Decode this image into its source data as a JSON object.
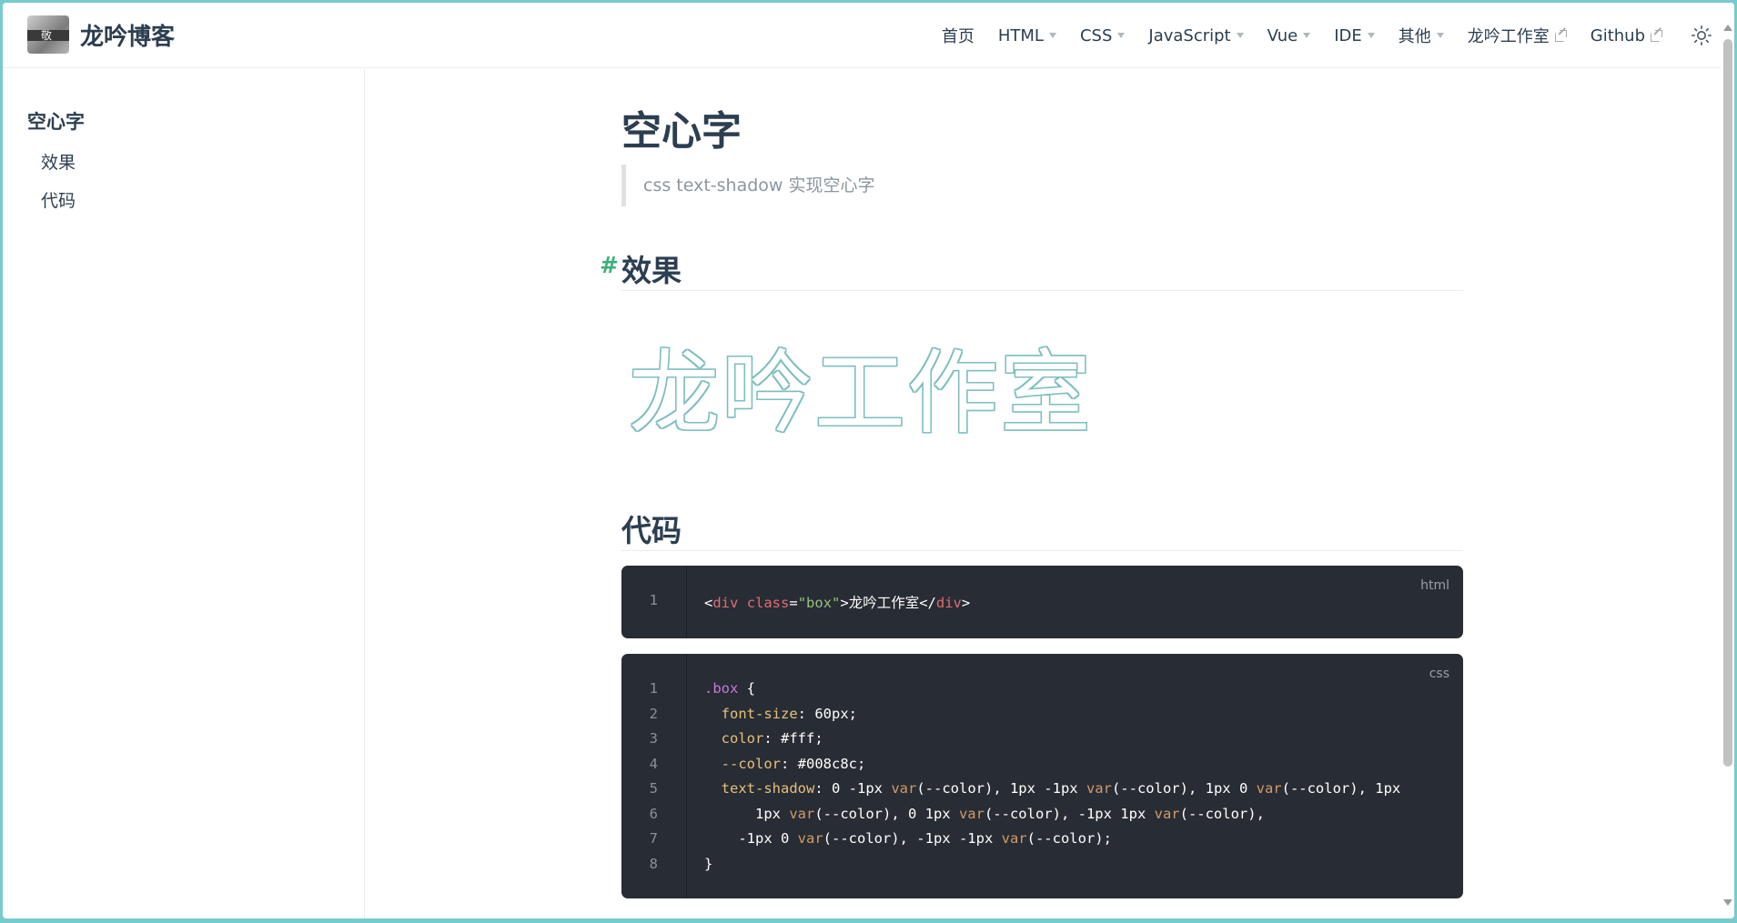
{
  "site": {
    "name": "龙吟博客",
    "logo_text": "敬"
  },
  "nav": {
    "items": [
      {
        "label": "首页",
        "dropdown": false,
        "external": false
      },
      {
        "label": "HTML",
        "dropdown": true,
        "external": false
      },
      {
        "label": "CSS",
        "dropdown": true,
        "external": false
      },
      {
        "label": "JavaScript",
        "dropdown": true,
        "external": false
      },
      {
        "label": "Vue",
        "dropdown": true,
        "external": false
      },
      {
        "label": "IDE",
        "dropdown": true,
        "external": false
      },
      {
        "label": "其他",
        "dropdown": true,
        "external": false
      },
      {
        "label": "龙吟工作室",
        "dropdown": false,
        "external": true
      },
      {
        "label": "Github",
        "dropdown": false,
        "external": true
      }
    ],
    "theme_icon": "sun-icon"
  },
  "sidebar": {
    "title": "空心字",
    "items": [
      {
        "label": "效果"
      },
      {
        "label": "代码"
      }
    ]
  },
  "page": {
    "title": "空心字",
    "quote": "css text-shadow 实现空心字",
    "h2_effect": "效果",
    "anchor": "#",
    "demo_text": "龙吟工作室",
    "h2_code": "代码"
  },
  "code_html": {
    "lang": "html",
    "line_numbers": [
      "1"
    ],
    "lines": [
      [
        {
          "t": "<",
          "c": ""
        },
        {
          "t": "div",
          "c": "tk-tag"
        },
        {
          "t": " ",
          "c": ""
        },
        {
          "t": "class",
          "c": "tk-attr"
        },
        {
          "t": "=",
          "c": ""
        },
        {
          "t": "\"box\"",
          "c": "tk-str"
        },
        {
          "t": ">龙吟工作室</",
          "c": ""
        },
        {
          "t": "div",
          "c": "tk-tag"
        },
        {
          "t": ">",
          "c": ""
        }
      ]
    ]
  },
  "code_css": {
    "lang": "css",
    "line_numbers": [
      "1",
      "2",
      "3",
      "4",
      "5",
      "6",
      "7",
      "8"
    ],
    "lines": [
      [
        {
          "t": ".box",
          "c": "tk-sel"
        },
        {
          "t": " {",
          "c": ""
        }
      ],
      [
        {
          "t": "  ",
          "c": ""
        },
        {
          "t": "font-size",
          "c": "tk-prop"
        },
        {
          "t": ": 60px;",
          "c": ""
        }
      ],
      [
        {
          "t": "  ",
          "c": ""
        },
        {
          "t": "color",
          "c": "tk-prop"
        },
        {
          "t": ": #fff;",
          "c": ""
        }
      ],
      [
        {
          "t": "  ",
          "c": ""
        },
        {
          "t": "--color",
          "c": "tk-prop"
        },
        {
          "t": ": #008c8c;",
          "c": ""
        }
      ],
      [
        {
          "t": "  ",
          "c": ""
        },
        {
          "t": "text-shadow",
          "c": "tk-prop"
        },
        {
          "t": ": 0 -1px ",
          "c": ""
        },
        {
          "t": "var",
          "c": "tk-fn"
        },
        {
          "t": "(--color), 1px -1px ",
          "c": ""
        },
        {
          "t": "var",
          "c": "tk-fn"
        },
        {
          "t": "(--color), 1px 0 ",
          "c": ""
        },
        {
          "t": "var",
          "c": "tk-fn"
        },
        {
          "t": "(--color), 1px",
          "c": ""
        }
      ],
      [
        {
          "t": "      1px ",
          "c": ""
        },
        {
          "t": "var",
          "c": "tk-fn"
        },
        {
          "t": "(--color), 0 1px ",
          "c": ""
        },
        {
          "t": "var",
          "c": "tk-fn"
        },
        {
          "t": "(--color), -1px 1px ",
          "c": ""
        },
        {
          "t": "var",
          "c": "tk-fn"
        },
        {
          "t": "(--color),",
          "c": ""
        }
      ],
      [
        {
          "t": "    -1px 0 ",
          "c": ""
        },
        {
          "t": "var",
          "c": "tk-fn"
        },
        {
          "t": "(--color), -1px -1px ",
          "c": ""
        },
        {
          "t": "var",
          "c": "tk-fn"
        },
        {
          "t": "(--color);",
          "c": ""
        }
      ],
      [
        {
          "t": "}",
          "c": ""
        }
      ]
    ]
  },
  "colors": {
    "accent": "#3eaf7c",
    "outline": "#008c8c",
    "code_bg": "#282c34",
    "frame": "#78cbcc"
  }
}
